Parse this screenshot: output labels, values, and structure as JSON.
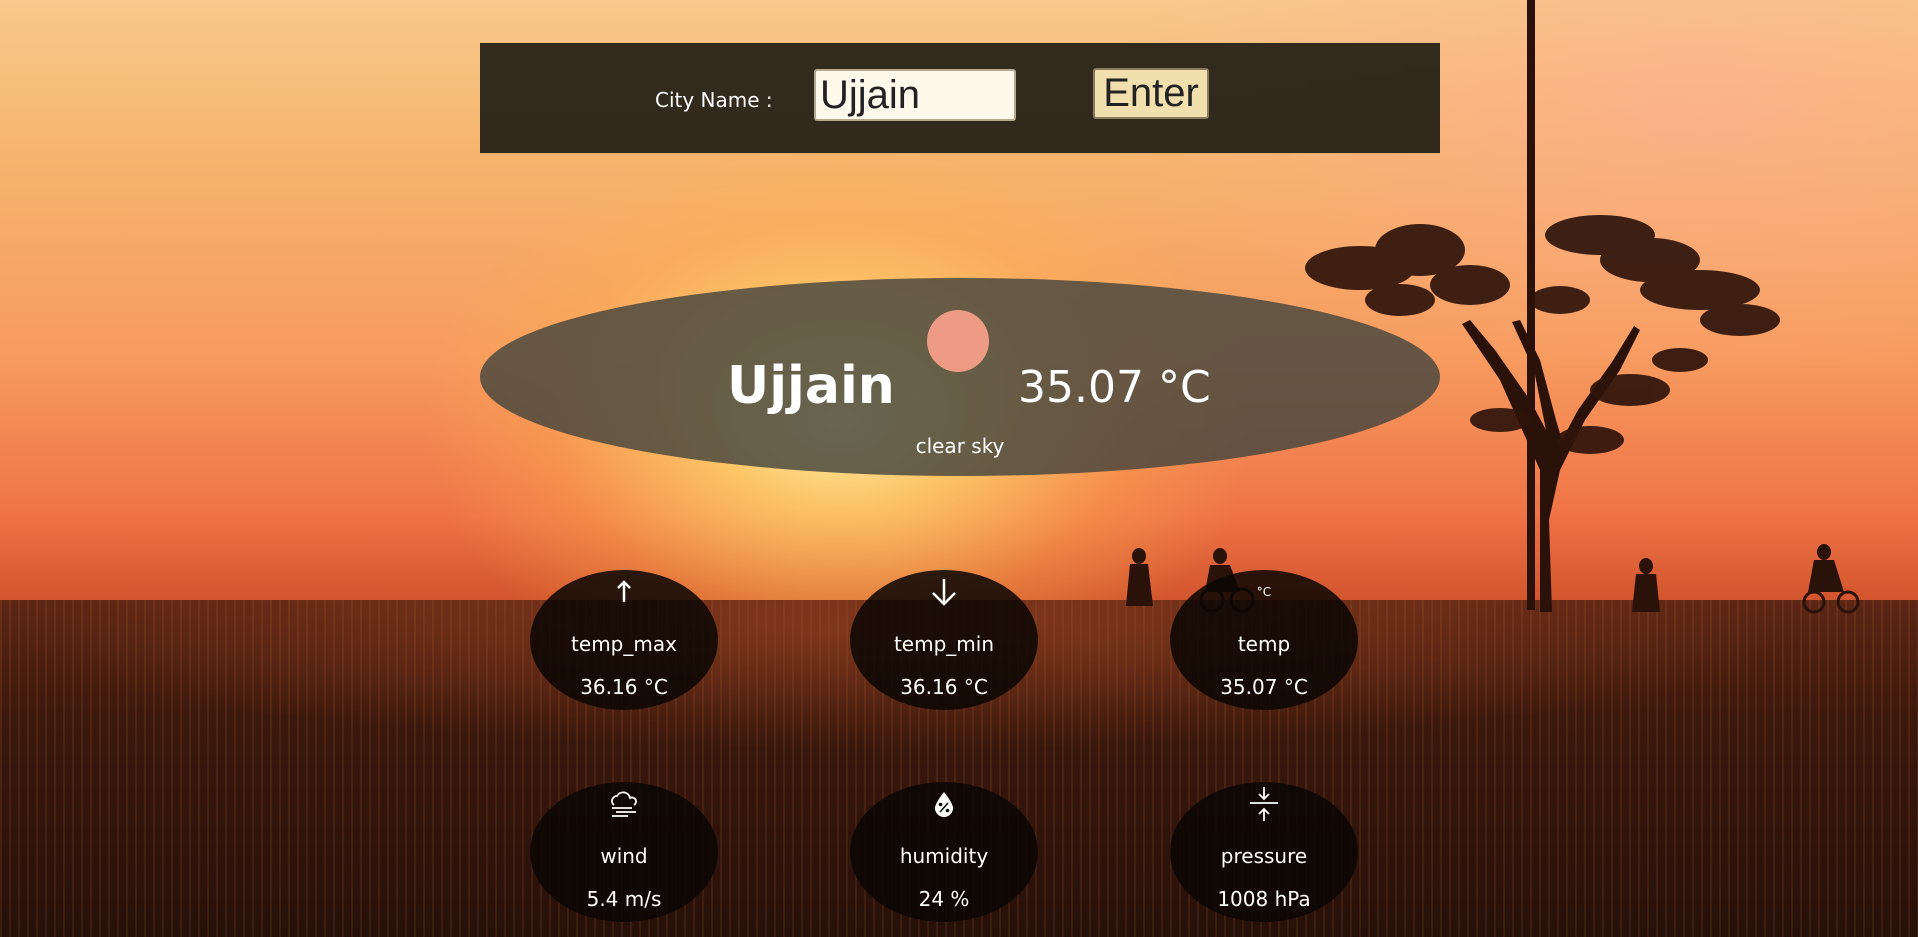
{
  "search": {
    "label": "City Name :",
    "value": "Ujjain",
    "button_label": "Enter"
  },
  "current": {
    "city": "Ujjain",
    "temperature": "35.07 °C",
    "description": "clear sky"
  },
  "stats": {
    "temp_max": {
      "label": "temp_max",
      "value": "36.16 °C",
      "icon": "arrow-up-icon"
    },
    "temp_min": {
      "label": "temp_min",
      "value": "36.16 °C",
      "icon": "arrow-down-icon"
    },
    "temp": {
      "label": "temp",
      "value": "35.07 °C",
      "icon": "celsius-icon",
      "icon_text": "°C"
    },
    "wind": {
      "label": "wind",
      "value": "5.4 m/s",
      "icon": "cloud-wind-icon"
    },
    "humidity": {
      "label": "humidity",
      "value": "24 %",
      "icon": "humidity-drop-icon"
    },
    "pressure": {
      "label": "pressure",
      "value": "1008 hPa",
      "icon": "pressure-arrows-icon"
    }
  },
  "colors": {
    "search_bar": "#2a2319",
    "input_bg": "#fff9ec",
    "button_bg": "#f2dfae",
    "weather_icon": "#ee9b85",
    "main_card": "#46463e",
    "stat_card": "#0a0604"
  }
}
